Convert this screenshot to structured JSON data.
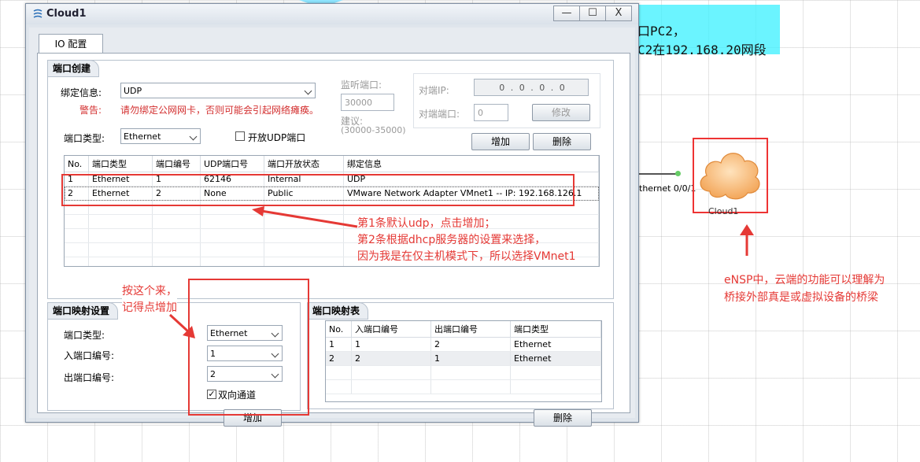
{
  "background": {
    "note_lines": [
      "口PC2，",
      "C2在192.168.20网段"
    ],
    "link_label": "thernet 0/0/1",
    "cloud_label": "Cloud1",
    "ensp_note": [
      "eNSP中，云端的功能可以理解为",
      "桥接外部真是或虚拟设备的桥梁"
    ]
  },
  "window": {
    "title": "Cloud1",
    "buttons": {
      "minimize": "—",
      "maximize": "☐",
      "close": "X"
    },
    "tab": "IO 配置"
  },
  "port_create": {
    "title": "端口创建",
    "bind_label": "绑定信息:",
    "bind_value": "UDP",
    "warning_label": "警告:",
    "warning_text": "请勿绑定公网网卡，否则可能会引起网络瘫痪。",
    "type_label": "端口类型:",
    "type_value": "Ethernet",
    "open_udp_label": "开放UDP端口",
    "listen_label": "监听端口:",
    "listen_value": "30000",
    "suggest_label": "建议:",
    "suggest_range": "(30000-35000)",
    "peer_ip_label": "对端IP:",
    "peer_ip_value": "0 . 0 . 0 . 0",
    "peer_port_label": "对端端口:",
    "peer_port_value": "0",
    "modify_btn": "修改",
    "add_btn": "增加",
    "delete_btn": "删除",
    "columns": [
      "No.",
      "端口类型",
      "端口编号",
      "UDP端口号",
      "端口开放状态",
      "绑定信息"
    ],
    "rows": [
      [
        "1",
        "Ethernet",
        "1",
        "62146",
        "Internal",
        "UDP"
      ],
      [
        "2",
        "Ethernet",
        "2",
        "None",
        "Public",
        "VMware Network Adapter VMnet1 -- IP: 192.168.126.1"
      ]
    ]
  },
  "mapping_settings": {
    "title": "端口映射设置",
    "type_label": "端口类型:",
    "type_value": "Ethernet",
    "in_label": "入端口编号:",
    "in_value": "1",
    "out_label": "出端口编号:",
    "out_value": "2",
    "bidirectional_label": "双向通道",
    "bidirectional_checked": true,
    "add_btn": "增加"
  },
  "mapping_table": {
    "title": "端口映射表",
    "columns": [
      "No.",
      "入端口编号",
      "出端口编号",
      "端口类型"
    ],
    "rows": [
      [
        "1",
        "1",
        "2",
        "Ethernet"
      ],
      [
        "2",
        "2",
        "1",
        "Ethernet"
      ]
    ],
    "delete_btn": "删除"
  },
  "annotations": {
    "list_note": [
      "第1条默认udp，点击增加；",
      "第2条根据dhcp服务器的设置来选择，",
      "因为我是在仅主机模式下，所以选择VMnet1"
    ],
    "mapping_note": [
      "按这个来，",
      "记得点增加"
    ]
  },
  "colors": {
    "annotation": "#e53935",
    "note_bg": "#3af0ff"
  }
}
